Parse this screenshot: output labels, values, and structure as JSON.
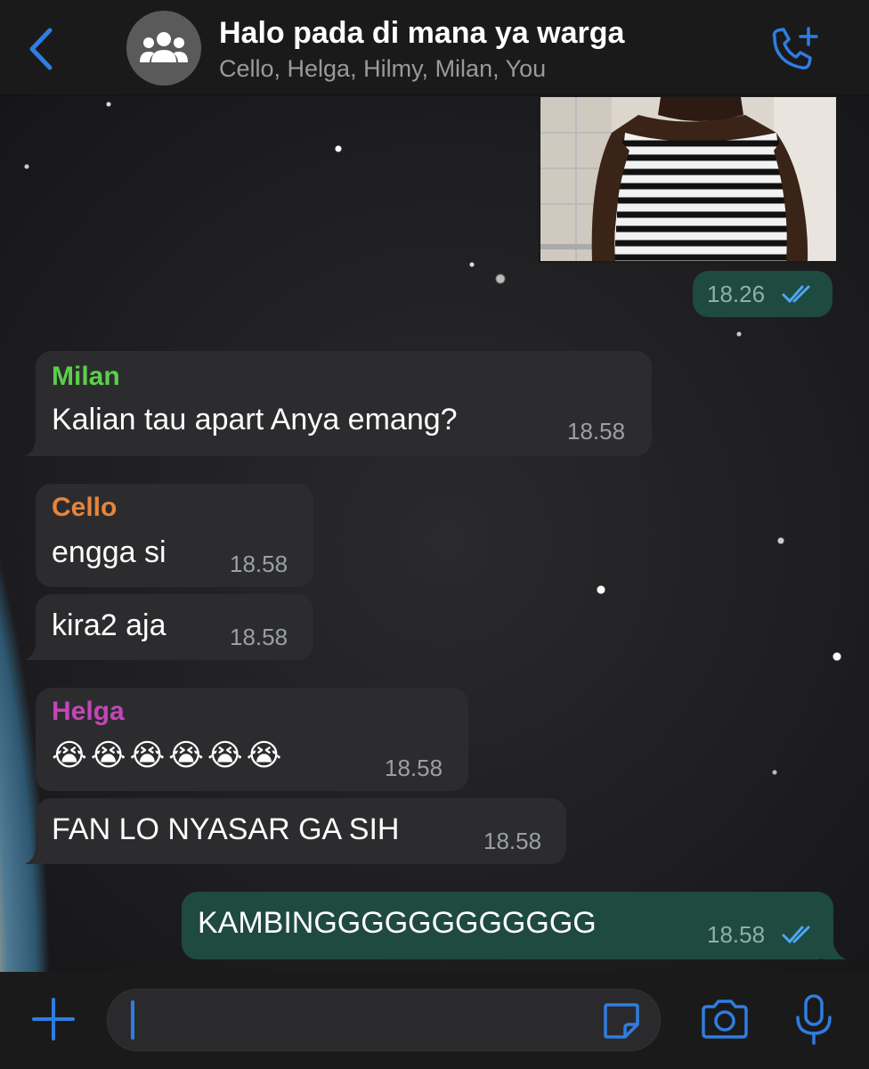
{
  "header": {
    "title": "Halo pada di mana ya warga",
    "subtitle": "Cello, Helga, Hilmy, Milan, You"
  },
  "messages": [
    {
      "kind": "photo",
      "time": "18.26",
      "status": "read"
    },
    {
      "sender": "Milan",
      "sender_color": "#5bd04a",
      "text": "Kalian tau apart Anya emang?",
      "time": "18.58"
    },
    {
      "sender": "Cello",
      "sender_color": "#e8843a",
      "text": "engga si",
      "time": "18.58"
    },
    {
      "text": "kira2 aja",
      "time": "18.58"
    },
    {
      "sender": "Helga",
      "sender_color": "#c346b8",
      "text": "😭😭😭😭😭😭",
      "time": "18.58"
    },
    {
      "text": "FAN LO NYASAR GA SIH",
      "time": "18.58"
    },
    {
      "text": "KAMBINGGGGGGGGGGGG",
      "time": "18.58",
      "status": "read",
      "outgoing": true
    }
  ],
  "colors": {
    "accent": "#2f7de1",
    "outgoing_bubble": "#1f4a3f",
    "incoming_bubble": "#2c2c2e"
  },
  "icons": {
    "back": "chevron-left-icon",
    "group": "group-avatar-icon",
    "call": "add-call-icon",
    "attach": "plus-icon",
    "sticker": "sticker-icon",
    "camera": "camera-icon",
    "mic": "mic-icon"
  }
}
